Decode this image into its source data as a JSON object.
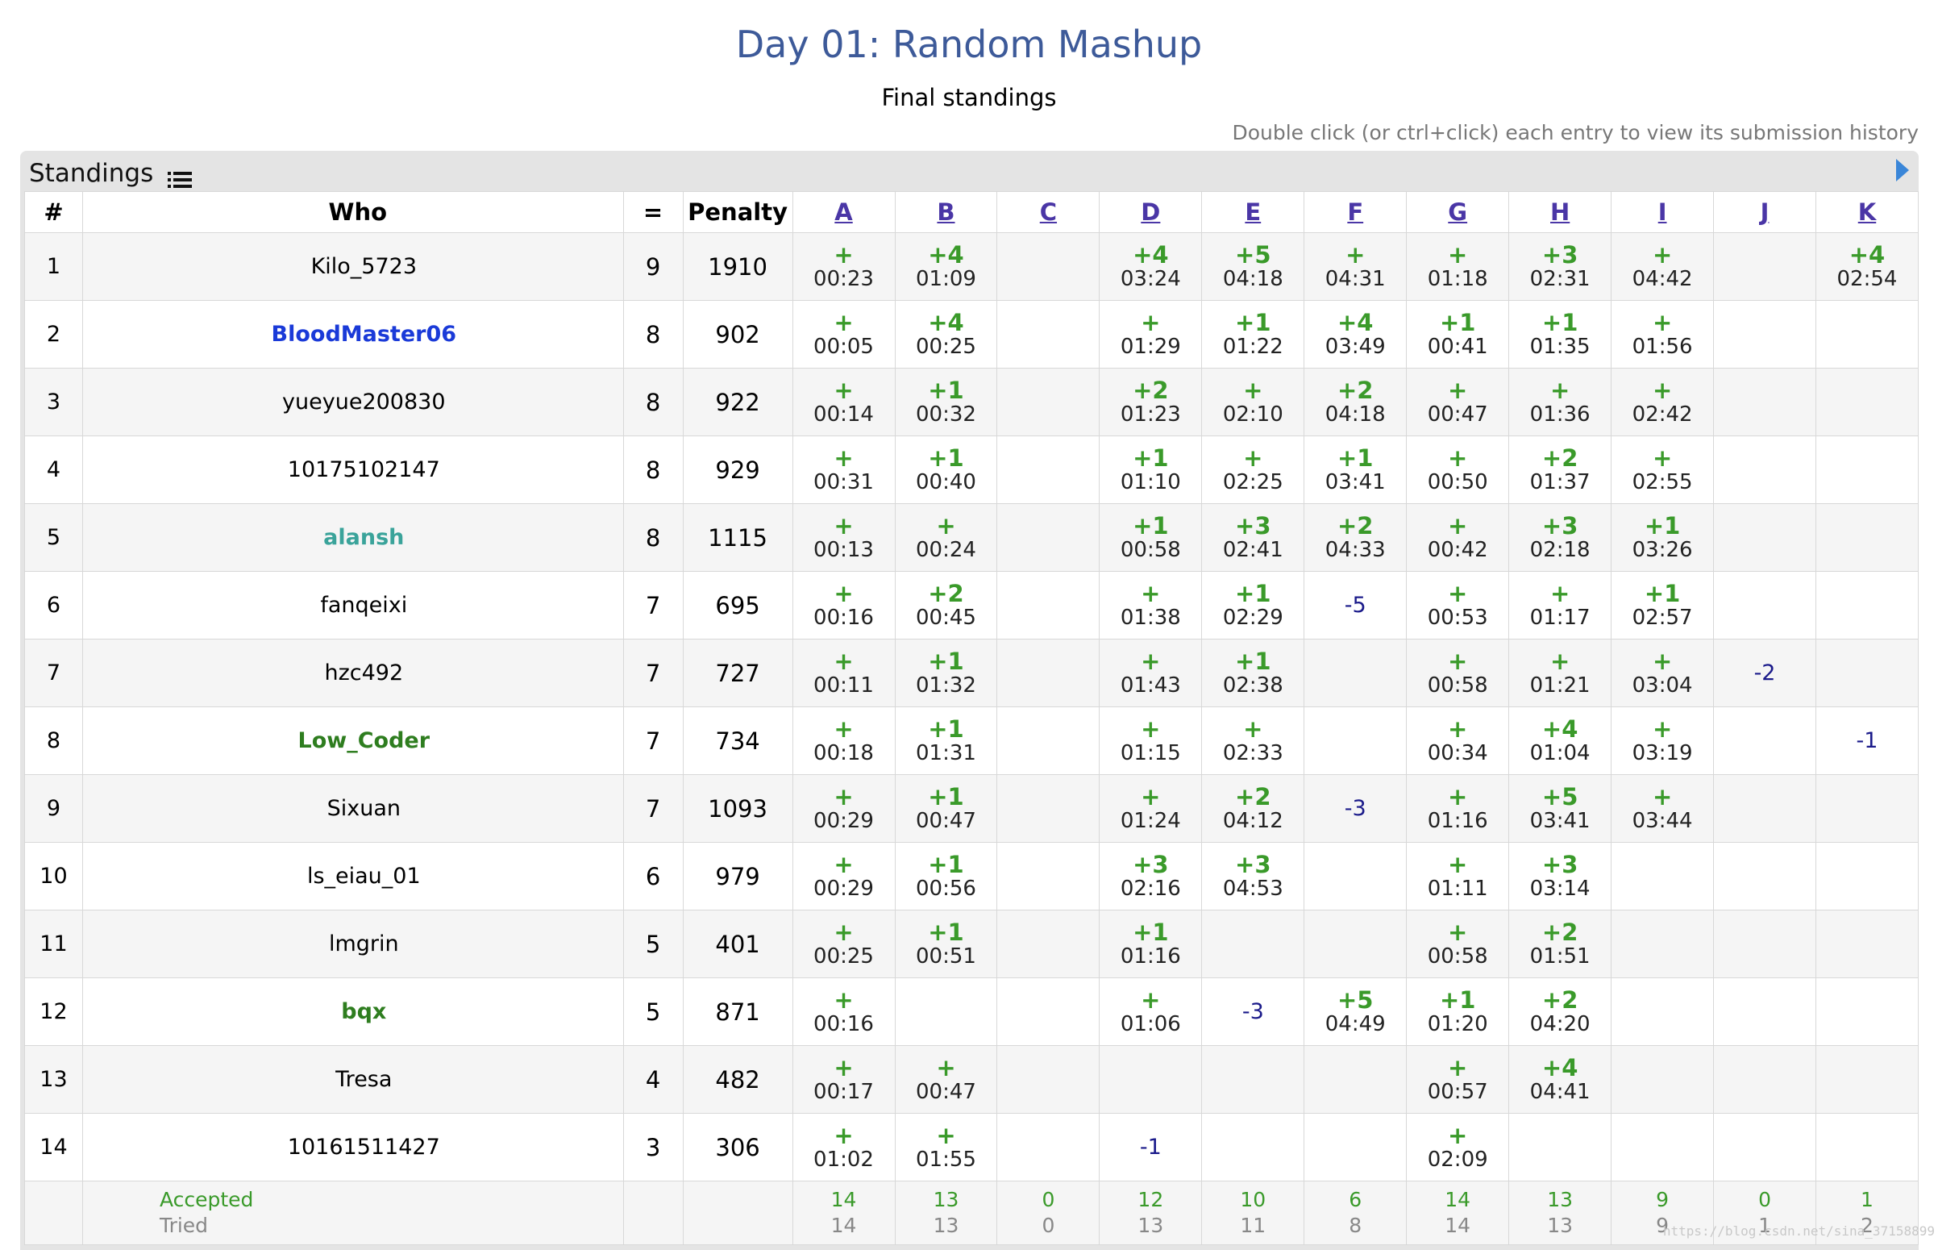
{
  "page": {
    "title": "Day 01: Random Mashup",
    "subtitle": "Final standings",
    "hint": "Double click (or ctrl+click) each entry to view its submission history"
  },
  "panel": {
    "title": "Standings"
  },
  "header": {
    "rank": "#",
    "who": "Who",
    "solved": "=",
    "penalty": "Penalty"
  },
  "problems": [
    "A",
    "B",
    "C",
    "D",
    "E",
    "F",
    "G",
    "H",
    "I",
    "J",
    "K"
  ],
  "colors": {
    "accepted": "#3a9a2a",
    "wrong": "#1a1a8a",
    "title": "#3d5a99"
  },
  "rows": [
    {
      "rank": "1",
      "who": "Kilo_5723",
      "color": "#000000",
      "bold": false,
      "solved": "9",
      "penalty": "1910",
      "cells": [
        {
          "t": "+",
          "time": "00:23"
        },
        {
          "t": "+4",
          "time": "01:09"
        },
        {},
        {
          "t": "+4",
          "time": "03:24"
        },
        {
          "t": "+5",
          "time": "04:18"
        },
        {
          "t": "+",
          "time": "04:31"
        },
        {
          "t": "+",
          "time": "01:18"
        },
        {
          "t": "+3",
          "time": "02:31"
        },
        {
          "t": "+",
          "time": "04:42"
        },
        {},
        {
          "t": "+4",
          "time": "02:54"
        }
      ]
    },
    {
      "rank": "2",
      "who": "BloodMaster06",
      "color": "#1a3ad8",
      "bold": true,
      "solved": "8",
      "penalty": "902",
      "cells": [
        {
          "t": "+",
          "time": "00:05"
        },
        {
          "t": "+4",
          "time": "00:25"
        },
        {},
        {
          "t": "+",
          "time": "01:29"
        },
        {
          "t": "+1",
          "time": "01:22"
        },
        {
          "t": "+4",
          "time": "03:49"
        },
        {
          "t": "+1",
          "time": "00:41"
        },
        {
          "t": "+1",
          "time": "01:35"
        },
        {
          "t": "+",
          "time": "01:56"
        },
        {},
        {}
      ]
    },
    {
      "rank": "3",
      "who": "yueyue200830",
      "color": "#000000",
      "bold": false,
      "solved": "8",
      "penalty": "922",
      "cells": [
        {
          "t": "+",
          "time": "00:14"
        },
        {
          "t": "+1",
          "time": "00:32"
        },
        {},
        {
          "t": "+2",
          "time": "01:23"
        },
        {
          "t": "+",
          "time": "02:10"
        },
        {
          "t": "+2",
          "time": "04:18"
        },
        {
          "t": "+",
          "time": "00:47"
        },
        {
          "t": "+",
          "time": "01:36"
        },
        {
          "t": "+",
          "time": "02:42"
        },
        {},
        {}
      ]
    },
    {
      "rank": "4",
      "who": "10175102147",
      "color": "#000000",
      "bold": false,
      "solved": "8",
      "penalty": "929",
      "cells": [
        {
          "t": "+",
          "time": "00:31"
        },
        {
          "t": "+1",
          "time": "00:40"
        },
        {},
        {
          "t": "+1",
          "time": "01:10"
        },
        {
          "t": "+",
          "time": "02:25"
        },
        {
          "t": "+1",
          "time": "03:41"
        },
        {
          "t": "+",
          "time": "00:50"
        },
        {
          "t": "+2",
          "time": "01:37"
        },
        {
          "t": "+",
          "time": "02:55"
        },
        {},
        {}
      ]
    },
    {
      "rank": "5",
      "who": "alansh",
      "color": "#3aa39a",
      "bold": true,
      "solved": "8",
      "penalty": "1115",
      "cells": [
        {
          "t": "+",
          "time": "00:13"
        },
        {
          "t": "+",
          "time": "00:24"
        },
        {},
        {
          "t": "+1",
          "time": "00:58"
        },
        {
          "t": "+3",
          "time": "02:41"
        },
        {
          "t": "+2",
          "time": "04:33"
        },
        {
          "t": "+",
          "time": "00:42"
        },
        {
          "t": "+3",
          "time": "02:18"
        },
        {
          "t": "+1",
          "time": "03:26"
        },
        {},
        {}
      ]
    },
    {
      "rank": "6",
      "who": "fanqeixi",
      "color": "#000000",
      "bold": false,
      "solved": "7",
      "penalty": "695",
      "cells": [
        {
          "t": "+",
          "time": "00:16"
        },
        {
          "t": "+2",
          "time": "00:45"
        },
        {},
        {
          "t": "+",
          "time": "01:38"
        },
        {
          "t": "+1",
          "time": "02:29"
        },
        {
          "wa": "-5"
        },
        {
          "t": "+",
          "time": "00:53"
        },
        {
          "t": "+",
          "time": "01:17"
        },
        {
          "t": "+1",
          "time": "02:57"
        },
        {},
        {}
      ]
    },
    {
      "rank": "7",
      "who": "hzc492",
      "color": "#000000",
      "bold": false,
      "solved": "7",
      "penalty": "727",
      "cells": [
        {
          "t": "+",
          "time": "00:11"
        },
        {
          "t": "+1",
          "time": "01:32"
        },
        {},
        {
          "t": "+",
          "time": "01:43"
        },
        {
          "t": "+1",
          "time": "02:38"
        },
        {},
        {
          "t": "+",
          "time": "00:58"
        },
        {
          "t": "+",
          "time": "01:21"
        },
        {
          "t": "+",
          "time": "03:04"
        },
        {
          "wa": "-2"
        },
        {}
      ]
    },
    {
      "rank": "8",
      "who": "Low_Coder",
      "color": "#2e7d1f",
      "bold": true,
      "solved": "7",
      "penalty": "734",
      "cells": [
        {
          "t": "+",
          "time": "00:18"
        },
        {
          "t": "+1",
          "time": "01:31"
        },
        {},
        {
          "t": "+",
          "time": "01:15"
        },
        {
          "t": "+",
          "time": "02:33"
        },
        {},
        {
          "t": "+",
          "time": "00:34"
        },
        {
          "t": "+4",
          "time": "01:04"
        },
        {
          "t": "+",
          "time": "03:19"
        },
        {},
        {
          "wa": "-1"
        }
      ]
    },
    {
      "rank": "9",
      "who": "Sixuan",
      "color": "#000000",
      "bold": false,
      "solved": "7",
      "penalty": "1093",
      "cells": [
        {
          "t": "+",
          "time": "00:29"
        },
        {
          "t": "+1",
          "time": "00:47"
        },
        {},
        {
          "t": "+",
          "time": "01:24"
        },
        {
          "t": "+2",
          "time": "04:12"
        },
        {
          "wa": "-3"
        },
        {
          "t": "+",
          "time": "01:16"
        },
        {
          "t": "+5",
          "time": "03:41"
        },
        {
          "t": "+",
          "time": "03:44"
        },
        {},
        {}
      ]
    },
    {
      "rank": "10",
      "who": "ls_eiau_01",
      "color": "#000000",
      "bold": false,
      "solved": "6",
      "penalty": "979",
      "cells": [
        {
          "t": "+",
          "time": "00:29"
        },
        {
          "t": "+1",
          "time": "00:56"
        },
        {},
        {
          "t": "+3",
          "time": "02:16"
        },
        {
          "t": "+3",
          "time": "04:53"
        },
        {},
        {
          "t": "+",
          "time": "01:11"
        },
        {
          "t": "+3",
          "time": "03:14"
        },
        {},
        {},
        {}
      ]
    },
    {
      "rank": "11",
      "who": "lmgrin",
      "color": "#000000",
      "bold": false,
      "solved": "5",
      "penalty": "401",
      "cells": [
        {
          "t": "+",
          "time": "00:25"
        },
        {
          "t": "+1",
          "time": "00:51"
        },
        {},
        {
          "t": "+1",
          "time": "01:16"
        },
        {},
        {},
        {
          "t": "+",
          "time": "00:58"
        },
        {
          "t": "+2",
          "time": "01:51"
        },
        {},
        {},
        {}
      ]
    },
    {
      "rank": "12",
      "who": "bqx",
      "color": "#2e7d1f",
      "bold": true,
      "solved": "5",
      "penalty": "871",
      "cells": [
        {
          "t": "+",
          "time": "00:16"
        },
        {},
        {},
        {
          "t": "+",
          "time": "01:06"
        },
        {
          "wa": "-3"
        },
        {
          "t": "+5",
          "time": "04:49"
        },
        {
          "t": "+1",
          "time": "01:20"
        },
        {
          "t": "+2",
          "time": "04:20"
        },
        {},
        {},
        {}
      ]
    },
    {
      "rank": "13",
      "who": "Tresa",
      "color": "#000000",
      "bold": false,
      "solved": "4",
      "penalty": "482",
      "cells": [
        {
          "t": "+",
          "time": "00:17"
        },
        {
          "t": "+",
          "time": "00:47"
        },
        {},
        {},
        {},
        {},
        {
          "t": "+",
          "time": "00:57"
        },
        {
          "t": "+4",
          "time": "04:41"
        },
        {},
        {},
        {}
      ]
    },
    {
      "rank": "14",
      "who": "10161511427",
      "color": "#000000",
      "bold": false,
      "solved": "3",
      "penalty": "306",
      "cells": [
        {
          "t": "+",
          "time": "01:02"
        },
        {
          "t": "+",
          "time": "01:55"
        },
        {},
        {
          "wa": "-1"
        },
        {},
        {},
        {
          "t": "+",
          "time": "02:09"
        },
        {},
        {},
        {},
        {}
      ]
    }
  ],
  "footer": {
    "accepted_label": "Accepted",
    "tried_label": "Tried",
    "accepted": [
      "14",
      "13",
      "0",
      "12",
      "10",
      "6",
      "14",
      "13",
      "9",
      "0",
      "1"
    ],
    "tried": [
      "14",
      "13",
      "0",
      "13",
      "11",
      "8",
      "14",
      "13",
      "9",
      "1",
      "2"
    ]
  },
  "watermark": "https://blog.csdn.net/sina_37158899"
}
